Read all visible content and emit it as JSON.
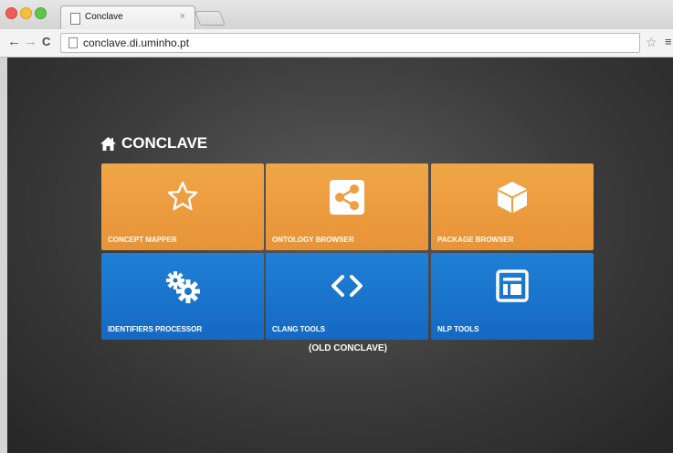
{
  "browser": {
    "tab_title": "Conclave",
    "tab_close": "×",
    "url": "conclave.di.uminho.pt",
    "icons": {
      "back": "←",
      "forward": "→",
      "reload": "C",
      "star": "☆",
      "menu": "≡"
    }
  },
  "page": {
    "title": "CONCLAVE",
    "tiles": [
      {
        "label": "CONCEPT MAPPER",
        "icon": "star-icon",
        "color": "#ef9e40"
      },
      {
        "label": "ONTOLOGY BROWSER",
        "icon": "share-icon",
        "color": "#ef9e40"
      },
      {
        "label": "PACKAGE BROWSER",
        "icon": "cube-icon",
        "color": "#ef9e40"
      },
      {
        "label": "IDENTIFIERS PROCESSOR",
        "icon": "gears-icon",
        "color": "#1a75cc"
      },
      {
        "label": "CLANG TOOLS",
        "icon": "code-icon",
        "color": "#1a75cc"
      },
      {
        "label": "NLP TOOLS",
        "icon": "window-icon",
        "color": "#1a75cc"
      }
    ],
    "footer_note": "(OLD CONCLAVE)"
  }
}
